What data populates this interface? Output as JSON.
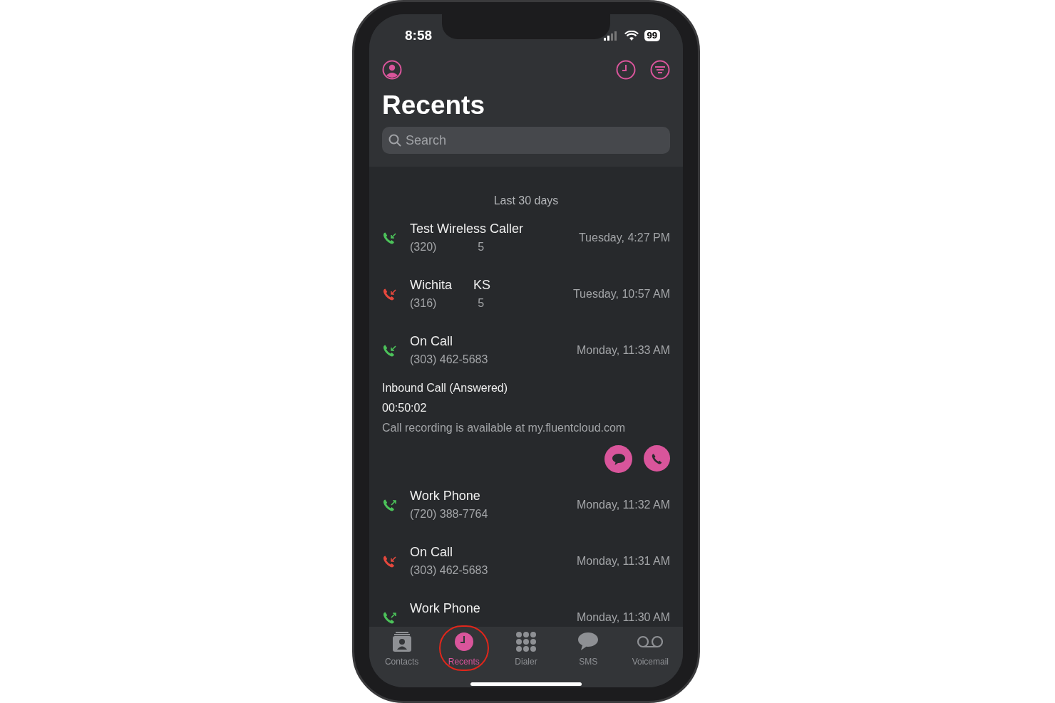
{
  "status_bar": {
    "time": "8:58",
    "battery": "99"
  },
  "header": {
    "title": "Recents",
    "search": {
      "placeholder": "Search"
    }
  },
  "section_label": "Last 30 days",
  "calls": [
    {
      "name": "Test Wireless Caller",
      "number": "(320)             5",
      "time": "Tuesday, 4:27 PM",
      "kind": "incoming",
      "missed": false
    },
    {
      "name": "Wichita      KS",
      "number": "(316)             5",
      "time": "Tuesday, 10:57 AM",
      "kind": "incoming",
      "missed": true
    },
    {
      "name": "On Call",
      "number": "(303) 462-5683",
      "time": "Monday, 11:33 AM",
      "kind": "incoming",
      "missed": false,
      "details": {
        "type": "Inbound Call (Answered)",
        "duration": "00:50:02",
        "note": "Call recording is available at my.fluentcloud.com"
      }
    },
    {
      "name": "Work Phone",
      "number": "(720) 388-7764",
      "time": "Monday, 11:32 AM",
      "kind": "outgoing",
      "missed": false
    },
    {
      "name": "On Call",
      "number": "(303) 462-5683",
      "time": "Monday, 11:31 AM",
      "kind": "incoming",
      "missed": true
    },
    {
      "name": "Work Phone",
      "time": "Monday, 11:30 AM",
      "kind": "outgoing",
      "missed": false
    }
  ],
  "tabs": [
    {
      "label": "Contacts",
      "kind": "contacts",
      "selected": false,
      "highlighted": false
    },
    {
      "label": "Recents",
      "kind": "recents",
      "selected": true,
      "highlighted": true
    },
    {
      "label": "Dialer",
      "kind": "dialer",
      "selected": false,
      "highlighted": false
    },
    {
      "label": "SMS",
      "kind": "sms",
      "selected": false,
      "highlighted": false
    },
    {
      "label": "Voicemail",
      "kind": "voicemail",
      "selected": false,
      "highlighted": false
    }
  ]
}
